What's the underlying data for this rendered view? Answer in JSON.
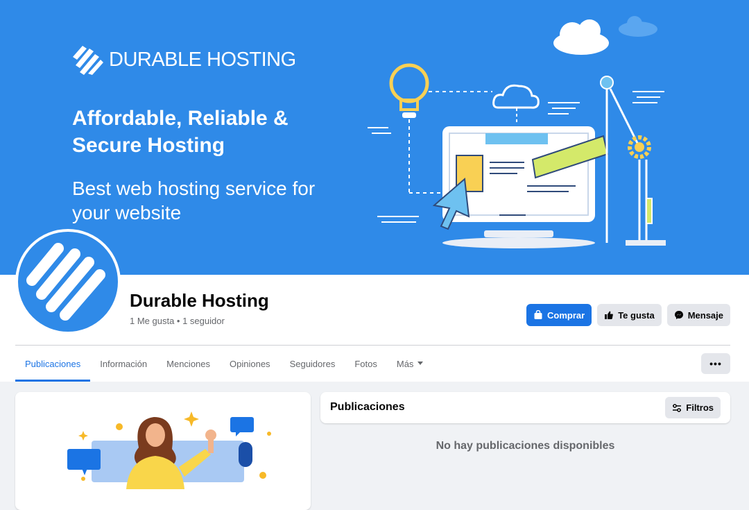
{
  "cover": {
    "brand_name": "DURABLE HOSTING",
    "tagline": "Affordable, Reliable & Secure Hosting",
    "subline": "Best web hosting service for your website",
    "background_color": "#2f8ae8"
  },
  "page": {
    "name": "Durable Hosting",
    "stats": "1 Me gusta • 1 seguidor"
  },
  "actions": {
    "buy_label": "Comprar",
    "like_label": "Te gusta",
    "message_label": "Mensaje",
    "buy_icon": "shopping-bag-icon",
    "like_icon": "thumbs-up-icon",
    "message_icon": "messenger-icon"
  },
  "tabs": [
    {
      "label": "Publicaciones",
      "active": true
    },
    {
      "label": "Información"
    },
    {
      "label": "Menciones"
    },
    {
      "label": "Opiniones"
    },
    {
      "label": "Seguidores"
    },
    {
      "label": "Fotos"
    },
    {
      "label": "Más"
    }
  ],
  "more_button": "•••",
  "posts": {
    "title": "Publicaciones",
    "filter_label": "Filtros",
    "filter_icon": "sliders-icon",
    "empty_message": "No hay publicaciones disponibles"
  },
  "colors": {
    "accent": "#1b74e4",
    "secondary_button": "#e4e6eb",
    "background": "#f0f2f5"
  }
}
